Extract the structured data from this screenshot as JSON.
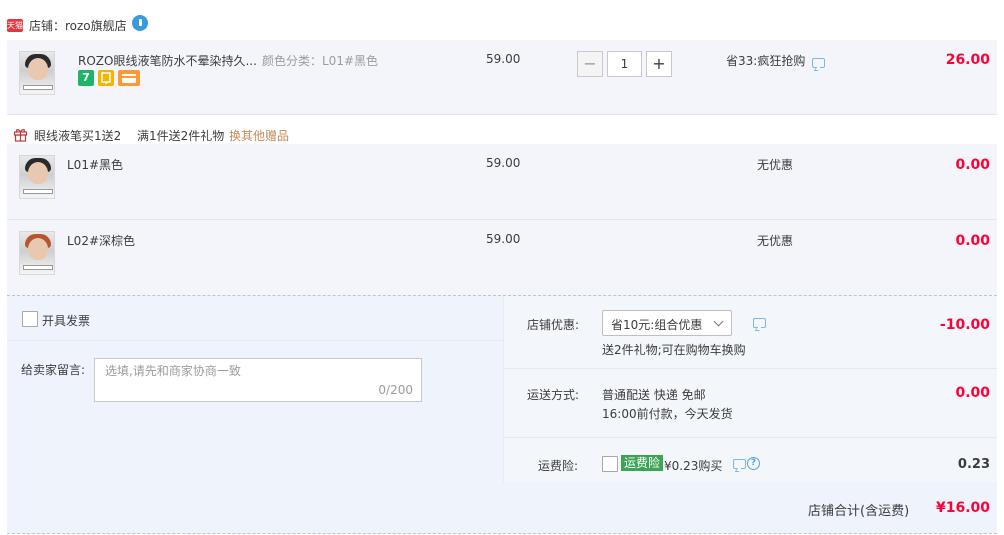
{
  "shop": {
    "badge": "天猫",
    "name": "店铺：rozo旗舰店"
  },
  "main_item": {
    "title": "ROZO眼线液笔防水不晕染持久...",
    "sku": "颜色分类：L01#黑色",
    "price": "59.00",
    "quantity": "1",
    "qty_minus": "−",
    "qty_plus": "+",
    "promo": "省33:疯狂抢购",
    "subtotal": "26.00",
    "badges": [
      {
        "text": "7",
        "color": "#1fb469"
      },
      {
        "text": "",
        "color": "#f5b400"
      },
      {
        "text": "",
        "color": "#ff9933"
      }
    ]
  },
  "gift_bar": {
    "title": "眼线液笔买1送2",
    "rule": "满1件送2件礼物",
    "link": "换其他赠品"
  },
  "gifts": [
    {
      "sku": "L01#黑色",
      "price": "59.00",
      "promo": "无优惠",
      "subtotal": "0.00"
    },
    {
      "sku": "L02#深棕色",
      "price": "59.00",
      "promo": "无优惠",
      "subtotal": "0.00"
    }
  ],
  "invoice": {
    "label": "开具发票"
  },
  "message": {
    "label": "给卖家留言:",
    "placeholder": "选填,请先和商家协商一致",
    "count": "0/200"
  },
  "discount": {
    "label": "店铺优惠:",
    "selected": "省10元:组合优惠",
    "note": "送2件礼物;可在购物车换购",
    "amount": "-10.00"
  },
  "shipping": {
    "label": "运送方式:",
    "method": "普通配送 快递 免邮",
    "time": "16:00前付款，今天发货",
    "amount": "0.00"
  },
  "insurance": {
    "label": "运费险:",
    "tag": "运费险",
    "price": "¥0.23购买",
    "amount": "0.23"
  },
  "footer": {
    "label": "店铺合计(含运费)",
    "total": "¥16.00"
  },
  "colors": {
    "accent_red": "#ff0036",
    "row_bg": "#f3f5fb",
    "panel_bg": "#eef3fc",
    "insurance_green": "#3ca454",
    "tmall_red": "#e4393c"
  }
}
